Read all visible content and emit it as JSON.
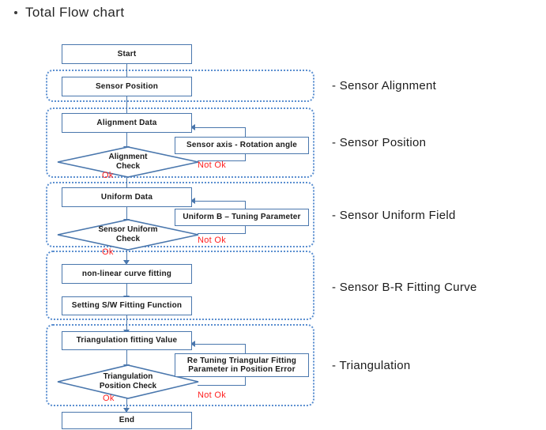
{
  "title": {
    "bullet": "bullet-dot",
    "text": "Total  Flow chart"
  },
  "colors": {
    "box_border": "#4a77ad",
    "group_border": "#5b8fd0",
    "branch_text": "#ff2020",
    "body_text": "#1a1a1a",
    "background": "#ffffff"
  },
  "flowchart": {
    "start": {
      "label": "Start"
    },
    "end": {
      "label": "End"
    },
    "nodes": {
      "sensor_position": {
        "label": "Sensor Position"
      },
      "alignment_data": {
        "label": "Alignment Data"
      },
      "sensor_axis_rotation": {
        "label": "Sensor axis - Rotation angle"
      },
      "alignment_check": {
        "label": "Alignment\nCheck",
        "line1": "Alignment",
        "line2": "Check"
      },
      "uniform_data": {
        "label": "Uniform Data"
      },
      "uniform_b_tuning": {
        "label": "Uniform B – Tuning  Parameter"
      },
      "sensor_uniform_check": {
        "line1": "Sensor Uniform",
        "line2": "Check"
      },
      "non_linear_curve_fitting": {
        "label": "non-linear  curve fitting"
      },
      "setting_sw_fitting_function": {
        "label": "Setting S/W Fitting Function"
      },
      "triangulation_fitting_value": {
        "label": "Triangulation fitting  Value"
      },
      "re_tuning_triangular": {
        "line1": "Re Tuning  Triangular Fitting",
        "line2": "Parameter in Position  Error"
      },
      "triangulation_position_check": {
        "line1": "Triangulation",
        "line2": "Position  Check"
      }
    },
    "branches": {
      "alignment_ok": "Ok",
      "alignment_not_ok": "Not Ok",
      "uniform_ok": "Ok",
      "uniform_not_ok": "Not Ok",
      "triangulation_ok": "Ok",
      "triangulation_not_ok": "Not Ok"
    }
  },
  "stages": [
    {
      "id": "sensor-alignment",
      "label": "- Sensor Alignment"
    },
    {
      "id": "sensor-position",
      "label": "- Sensor Position"
    },
    {
      "id": "sensor-uniform",
      "label": "- Sensor Uniform Field"
    },
    {
      "id": "sensor-br-fitting",
      "label": "- Sensor B-R Fitting Curve"
    },
    {
      "id": "triangulation",
      "label": "- Triangulation"
    }
  ]
}
